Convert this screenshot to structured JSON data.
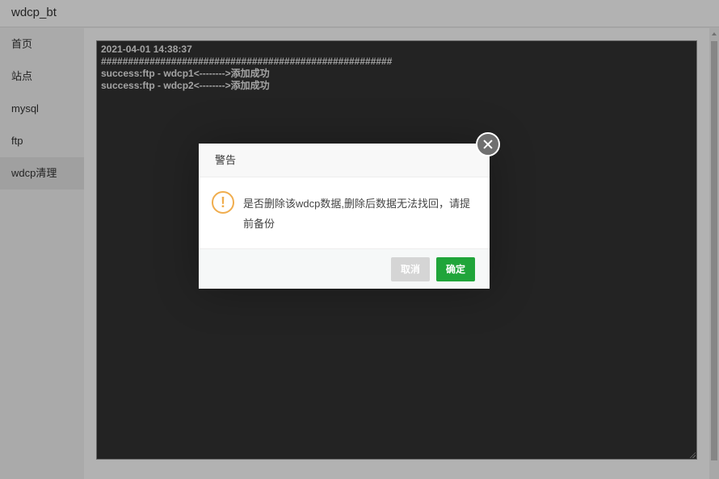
{
  "window": {
    "title": "wdcp_bt"
  },
  "sidebar": {
    "items": [
      {
        "label": "首页"
      },
      {
        "label": "站点"
      },
      {
        "label": "mysql"
      },
      {
        "label": "ftp"
      },
      {
        "label": "wdcp清理",
        "active": true
      }
    ]
  },
  "log": {
    "lines": [
      "2021-04-01 14:38:37",
      "######################################################",
      "success:ftp - wdcp1<-------->添加成功",
      "success:ftp - wdcp2<-------->添加成功"
    ]
  },
  "dialog": {
    "title": "警告",
    "icon": "warning-icon",
    "message": "是否删除该wdcp数据,删除后数据无法找回，请提前备份",
    "cancel_label": "取消",
    "confirm_label": "确定"
  },
  "colors": {
    "accent_green": "#20a53a",
    "warning_orange": "#f0ad4e",
    "log_background": "#333333"
  }
}
